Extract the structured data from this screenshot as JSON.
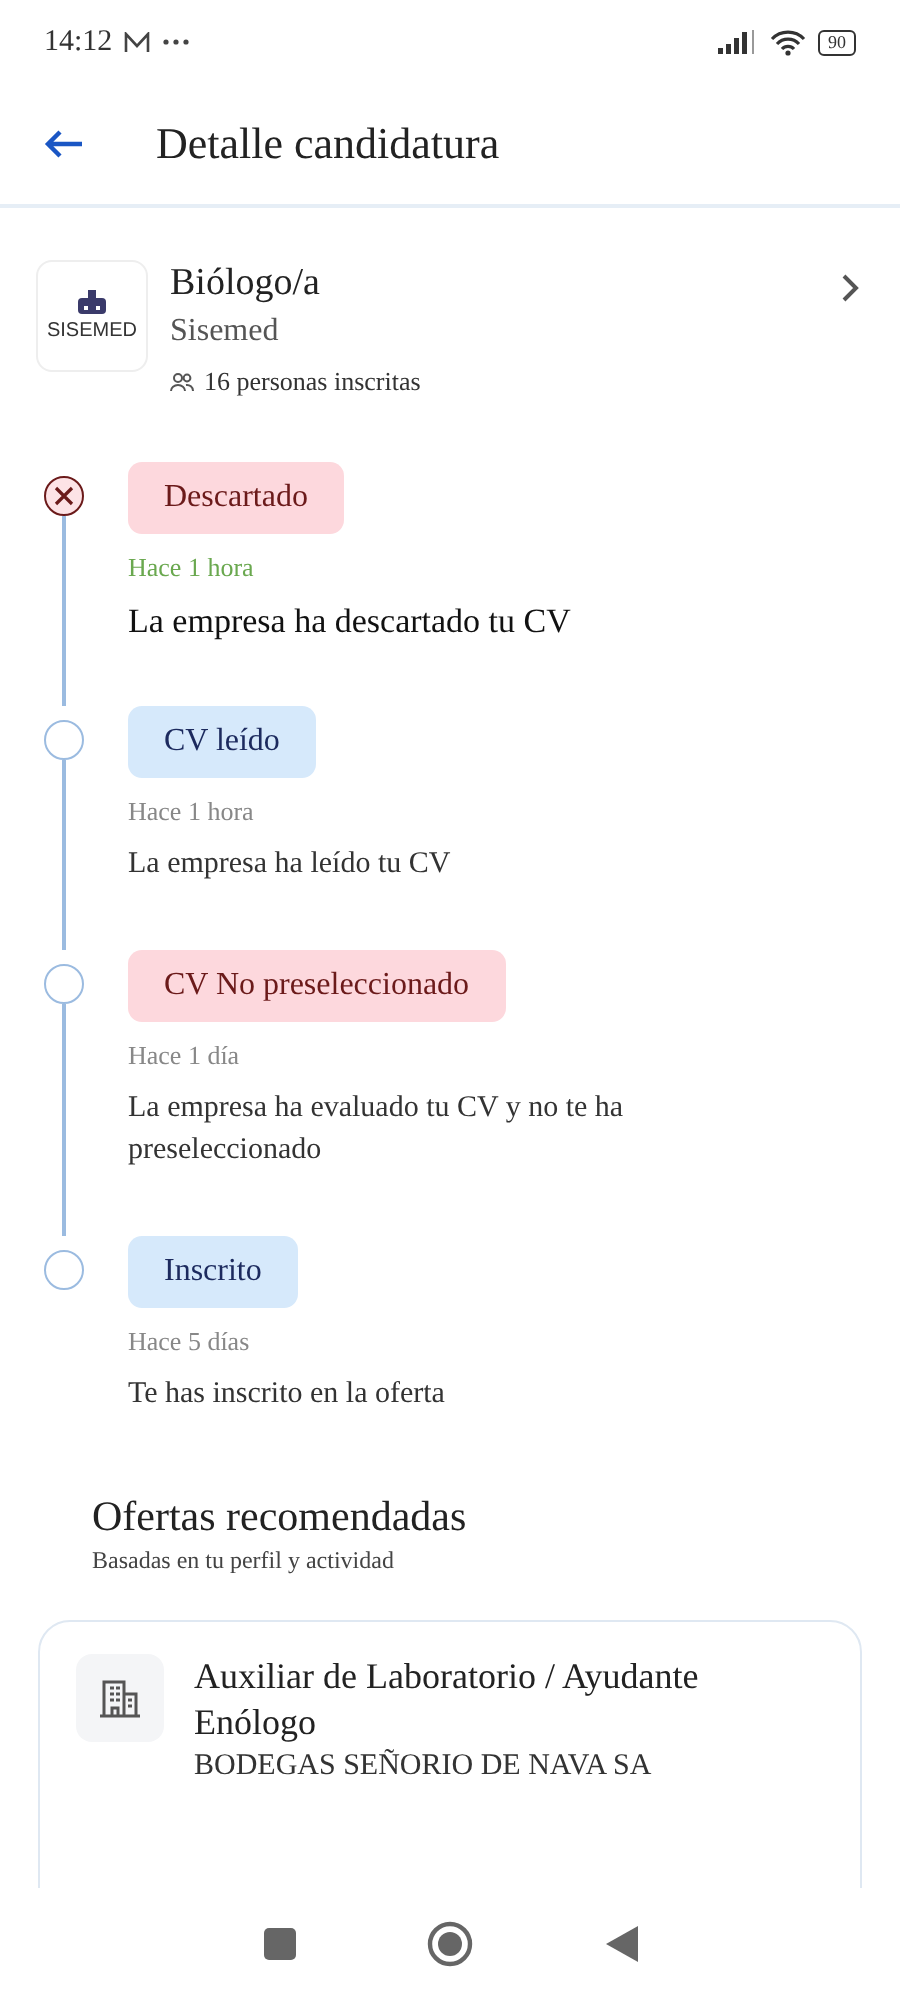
{
  "status_bar": {
    "time": "14:12",
    "battery": "90"
  },
  "header": {
    "title": "Detalle candidatura"
  },
  "job": {
    "logo_text": "SISEMED",
    "title": "Biólogo/a",
    "company": "Sisemed",
    "applicants": "16 personas inscritas"
  },
  "timeline": [
    {
      "kind": "rejected",
      "current": true,
      "badge": "Descartado",
      "time": "Hace 1 hora",
      "description": "La empresa ha descartado tu CV"
    },
    {
      "kind": "info",
      "current": false,
      "badge": "CV leído",
      "time": "Hace 1 hora",
      "description": "La empresa ha leído tu CV"
    },
    {
      "kind": "rejected",
      "current": false,
      "badge": "CV No preseleccionado",
      "time": "Hace 1 día",
      "description": "La empresa ha evaluado tu CV y no te ha preseleccionado"
    },
    {
      "kind": "info",
      "current": false,
      "badge": "Inscrito",
      "time": "Hace 5 días",
      "description": "Te has inscrito en la oferta"
    }
  ],
  "recommended": {
    "title": "Ofertas recomendadas",
    "subtitle": "Basadas en tu perfil y actividad",
    "offers": [
      {
        "title": "Auxiliar de Laboratorio / Ayudante Enólogo",
        "company": "BODEGAS SEÑORIO DE NAVA SA"
      }
    ]
  }
}
